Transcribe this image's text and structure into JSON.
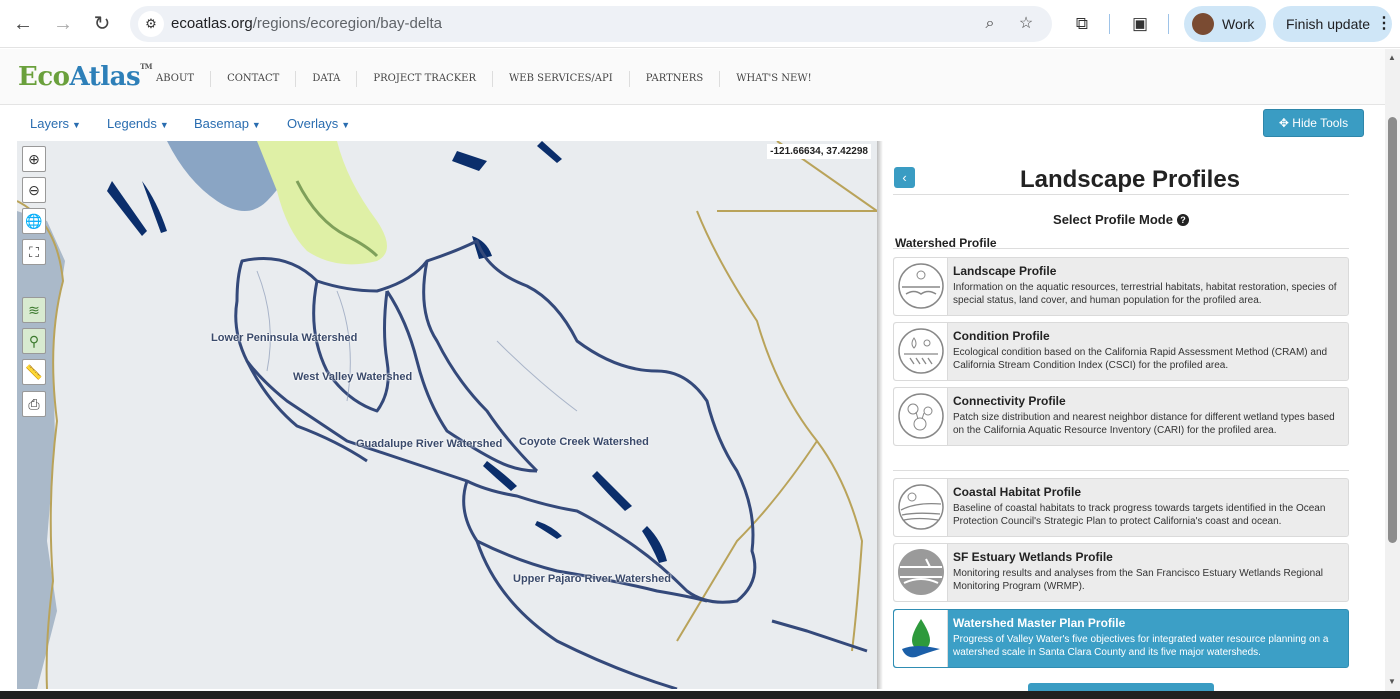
{
  "browser": {
    "url_domain": "ecoatlas.org",
    "url_path": "/regions/ecoregion/bay-delta",
    "profile_label": "Work",
    "update_label": "Finish update"
  },
  "site": {
    "logo_eco": "Eco",
    "logo_atlas": "Atlas",
    "logo_tm": "TM",
    "nav": [
      "ABOUT",
      "CONTACT",
      "DATA",
      "PROJECT TRACKER",
      "WEB SERVICES/API",
      "PARTNERS",
      "WHAT'S NEW!"
    ]
  },
  "toolbar": {
    "layers": "Layers",
    "legends": "Legends",
    "basemap": "Basemap",
    "overlays": "Overlays",
    "hide_tools": "Hide Tools"
  },
  "map": {
    "coordinates": "-121.66634, 37.42298",
    "watersheds": [
      "Lower Peninsula Watershed",
      "West Valley Watershed",
      "Guadalupe River Watershed",
      "Coyote Creek Watershed",
      "Upper Pajaro River Watershed"
    ]
  },
  "panel": {
    "title": "Landscape Profiles",
    "mode_label": "Select Profile Mode",
    "section": "Watershed Profile",
    "cards": [
      {
        "title": "Landscape Profile",
        "desc": "Information on the aquatic resources, terrestrial habitats, habitat restoration, species of special status, land cover, and human population for the profiled area."
      },
      {
        "title": "Condition Profile",
        "desc": "Ecological condition based on the California Rapid Assessment Method (CRAM) and California Stream Condition Index (CSCI) for the profiled area."
      },
      {
        "title": "Connectivity Profile",
        "desc": "Patch size distribution and nearest neighbor distance for different wetland types based on the California Aquatic Resource Inventory (CARI) for the profiled area."
      },
      {
        "title": "Coastal Habitat Profile",
        "desc": "Baseline of coastal habitats to track progress towards targets identified in the Ocean Protection Council's Strategic Plan to protect California's coast and ocean."
      },
      {
        "title": "SF Estuary Wetlands Profile",
        "desc": "Monitoring results and analyses from the San Francisco Estuary Wetlands Regional Monitoring Program (WRMP)."
      },
      {
        "title": "Watershed Master Plan Profile",
        "desc": "Progress of Valley Water's five objectives for integrated water resource planning on a watershed scale in Santa Clara County and its five major watersheds."
      }
    ]
  },
  "colors": {
    "accent": "#3a9cc3",
    "link": "#2a6db0",
    "watershed_outline": "#34497a",
    "water": "#0b2e6b"
  }
}
